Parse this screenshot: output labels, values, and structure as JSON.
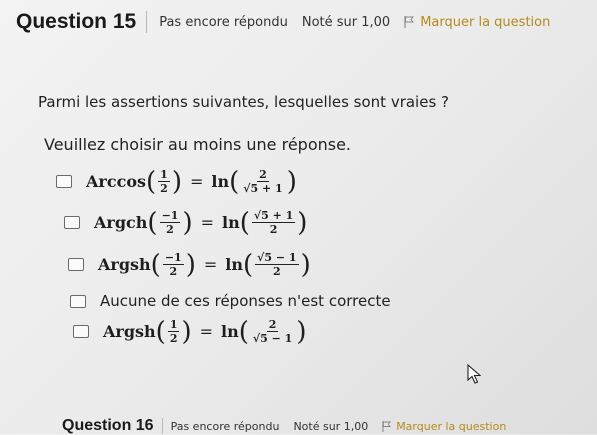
{
  "question": {
    "title": "Question 15",
    "status": "Pas encore répondu",
    "mark": "Noté sur 1,00",
    "flag_label": "Marquer la question"
  },
  "prompt": "Parmi les assertions suivantes, lesquelles sont vraies ?",
  "instruction": "Veuillez choisir au moins une réponse.",
  "options": [
    {
      "fn": "Arccos",
      "lnum": "1",
      "lden": "2",
      "eq": "=",
      "ln": "ln",
      "rnum": "2",
      "rden": "√5 + 1"
    },
    {
      "fn": "Argch",
      "lnum": "−1",
      "lden": "2",
      "eq": "=",
      "ln": "ln",
      "rnum": "√5 + 1",
      "rden": "2"
    },
    {
      "fn": "Argsh",
      "lnum": "−1",
      "lden": "2",
      "eq": "=",
      "ln": "ln",
      "rnum": "√5 − 1",
      "rden": "2"
    },
    {
      "text": "Aucune de ces réponses n'est correcte"
    },
    {
      "fn": "Argsh",
      "lnum": "1",
      "lden": "2",
      "eq": "=",
      "ln": "ln",
      "rnum": "2",
      "rden": "√5 − 1"
    }
  ],
  "next_question": {
    "title": "Question 16",
    "status": "Pas encore répondu",
    "mark": "Noté sur 1,00",
    "flag_label": "Marquer la question"
  },
  "colors": {
    "flag": "#b58a1c"
  },
  "icons": {
    "flag": "flag-icon",
    "cursor": "mouse-cursor-icon"
  }
}
